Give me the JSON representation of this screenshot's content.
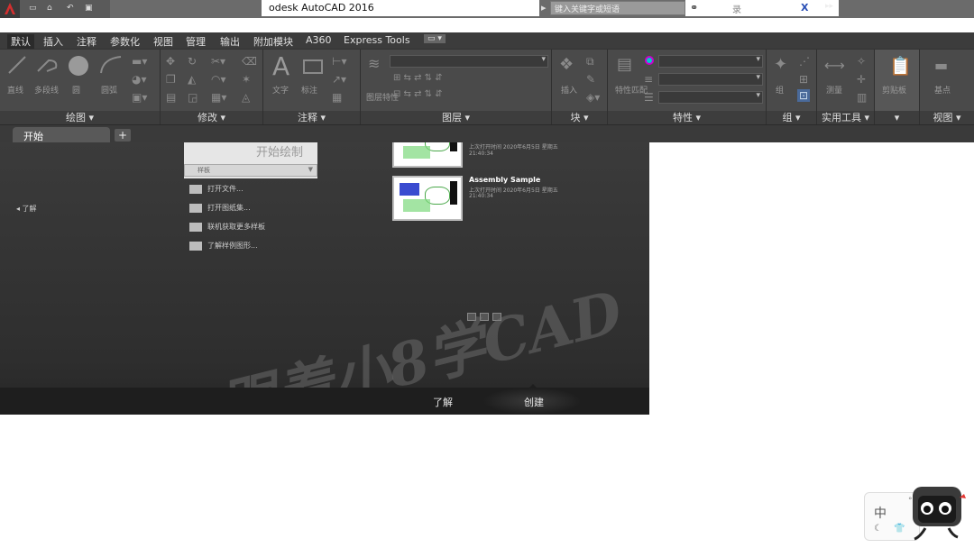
{
  "window": {
    "title": "odesk AutoCAD 2016",
    "search_placeholder": "键入关键字或短语",
    "sign_in": "录"
  },
  "menu_tabs": [
    {
      "label": "默认",
      "active": true
    },
    {
      "label": "插入"
    },
    {
      "label": "注释"
    },
    {
      "label": "参数化"
    },
    {
      "label": "视图"
    },
    {
      "label": "管理"
    },
    {
      "label": "输出"
    },
    {
      "label": "附加模块"
    },
    {
      "label": "A360"
    },
    {
      "label": "Express Tools"
    }
  ],
  "ribbon": {
    "draw": {
      "title": "绘图 ▾",
      "items": [
        "直线",
        "多段线",
        "圆",
        "圆弧"
      ]
    },
    "modify": {
      "title": "修改 ▾"
    },
    "annotation": {
      "title": "注释 ▾",
      "items": [
        "文字",
        "标注"
      ]
    },
    "layers": {
      "title": "图层 ▾",
      "items": [
        "图层特性"
      ]
    },
    "block": {
      "title": "块 ▾",
      "items": [
        "插入"
      ]
    },
    "properties": {
      "title": "特性 ▾",
      "items": [
        "特性匹配"
      ]
    },
    "groups": {
      "title": "组 ▾",
      "items": [
        "组"
      ]
    },
    "utilities": {
      "title": "实用工具 ▾",
      "items": [
        "测量"
      ]
    },
    "clipboard": {
      "title": "▾",
      "items": [
        "剪贴板"
      ]
    },
    "view": {
      "title": "视图 ▾",
      "items": [
        "基点"
      ]
    }
  },
  "file_tabs": {
    "start": "开始",
    "add": "+"
  },
  "start_page": {
    "learn_toggle": "◂ 了解",
    "start_drawing": "开始绘制",
    "template_combo": "样板",
    "links": [
      "打开文件...",
      "打开图纸集...",
      "联机获取更多样板",
      "了解样例图形..."
    ],
    "recent": [
      {
        "name": "",
        "meta1": "上次打开时间 2020年6月5日 星期五",
        "meta2": "21:40:34"
      },
      {
        "name": "Assembly Sample",
        "meta1": "上次打开时间 2020年6月5日 星期五",
        "meta2": "21:40:34"
      }
    ],
    "watermark": "跟着小8学CAD",
    "bottom_tabs": {
      "learn": "了解",
      "create": "创建"
    }
  },
  "ime": {
    "lang": "中"
  }
}
